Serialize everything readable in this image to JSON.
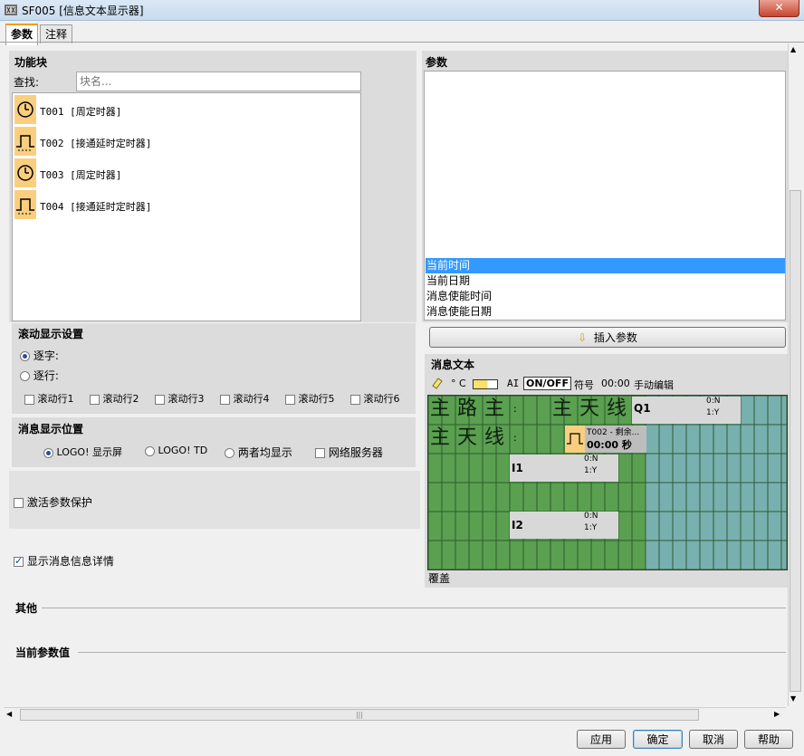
{
  "window": {
    "title": "SF005 [信息文本显示器]",
    "close": "✕"
  },
  "tabs": [
    {
      "label": "参数"
    },
    {
      "label": "注释"
    }
  ],
  "left": {
    "blocks_label": "功能块",
    "search_label": "查找:",
    "search_placeholder": "块名...",
    "blocks": [
      {
        "label": "T001 [周定时器]",
        "icon": "clock-icon"
      },
      {
        "label": "T002 [接通延时定时器]",
        "icon": "on-delay-icon"
      },
      {
        "label": "T003 [周定时器]",
        "icon": "clock-icon"
      },
      {
        "label": "T004 [接通延时定时器]",
        "icon": "on-delay-icon"
      }
    ],
    "scroll_title": "滚动显示设置",
    "scroll_options": [
      "逐字:",
      "逐行:"
    ],
    "scroll_lines": [
      "滚动行1",
      "滚动行2",
      "滚动行3",
      "滚动行4",
      "滚动行5",
      "滚动行6"
    ],
    "pos_title": "消息显示位置",
    "pos_options": [
      "LOGO! 显示屏",
      "LOGO! TD",
      "两者均显示",
      "网络服务器"
    ],
    "protect_label": "激活参数保护",
    "details_label": "显示消息信息详情"
  },
  "right": {
    "params_label": "参数",
    "param_items": [
      "当前时间",
      "当前日期",
      "消息使能时间",
      "消息使能日期"
    ],
    "insert_button": "插入参数",
    "msg_label": "消息文本",
    "toolbar": {
      "deg": "° C",
      "ai": "AI",
      "onoff": "ON/OFF",
      "symbol": "符号",
      "time": "00:00",
      "manual": "手动编辑"
    },
    "grid": {
      "row1_chars": [
        "主",
        "路",
        "主",
        "主",
        "天",
        "线"
      ],
      "row2_chars": [
        "主",
        "天",
        "线"
      ],
      "q1": "Q1",
      "q1_states": [
        "0:N",
        "1:Y"
      ],
      "t002": "T002 - 剩余...",
      "t002_val": "00:00 秒 (...",
      "i1": "I1",
      "i1_states": [
        "0:N",
        "1:Y"
      ],
      "i2": "I2",
      "i2_states": [
        "0:N",
        "1:Y"
      ],
      "colon": ":"
    },
    "overwrite": "覆盖"
  },
  "bottom": {
    "other_label": "其他",
    "current_label": "当前参数值",
    "hscroll_thumb": "|||"
  },
  "buttons": {
    "apply": "应用",
    "ok": "确定",
    "cancel": "取消",
    "help": "帮助"
  },
  "colors": {
    "green": "#5aa050",
    "teal": "#78b0b0",
    "select": "#3399ff",
    "orange": "#f9cf7f"
  }
}
